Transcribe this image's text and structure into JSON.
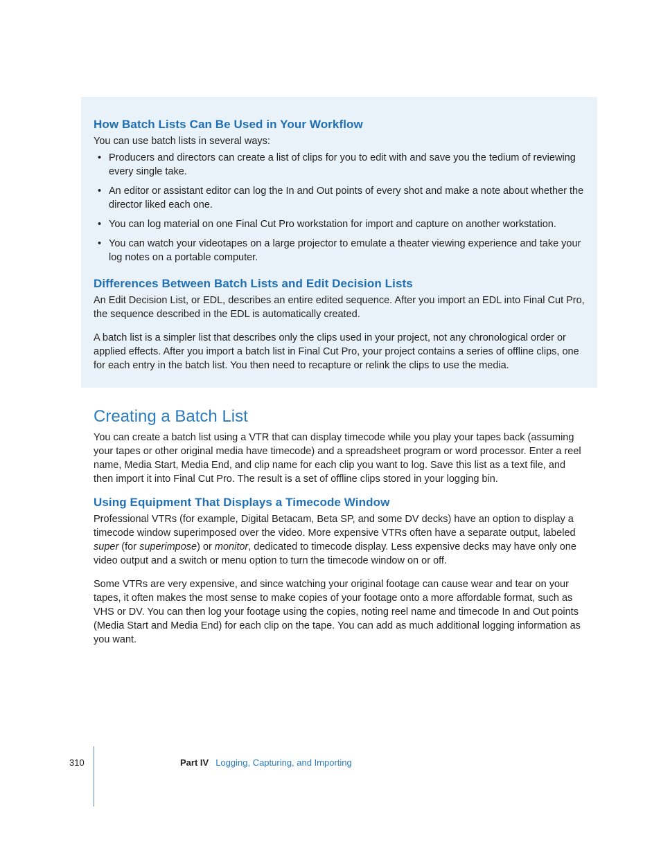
{
  "callout": {
    "h3a": "How Batch Lists Can Be Used in Your Workflow",
    "intro": "You can use batch lists in several ways:",
    "bullets": [
      "Producers and directors can create a list of clips for you to edit with and save you the tedium of reviewing every single take.",
      "An editor or assistant editor can log the In and Out points of every shot and make a note about whether the director liked each one.",
      "You can log material on one Final Cut Pro workstation for import and capture on another workstation.",
      "You can watch your videotapes on a large projector to emulate a theater viewing experience and take your log notes on a portable computer."
    ],
    "h3b": "Differences Between Batch Lists and Edit Decision Lists",
    "p1": "An Edit Decision List, or EDL, describes an entire edited sequence. After you import an EDL into Final Cut Pro, the sequence described in the EDL is automatically created.",
    "p2": "A batch list is a simpler list that describes only the clips used in your project, not any chronological order or applied effects. After you import a batch list in Final Cut Pro, your project contains a series of offline clips, one for each entry in the batch list. You then need to recapture or relink the clips to use the media."
  },
  "section1": {
    "h2": "Creating a Batch List",
    "p1": "You can create a batch list using a VTR that can display timecode while you play your tapes back (assuming your tapes or other original media have timecode) and a spreadsheet program or word processor. Enter a reel name, Media Start, Media End, and clip name for each clip you want to log. Save this list as a text file, and then import it into Final Cut Pro. The result is a set of offline clips stored in your logging bin."
  },
  "section2": {
    "h3": "Using Equipment That Displays a Timecode Window",
    "p1_pre": "Professional VTRs (for example, Digital Betacam, Beta SP, and some DV decks) have an option to display a timecode window superimposed over the video. More expensive VTRs often have a separate output, labeled ",
    "p1_em1": "super",
    "p1_mid1": " (for ",
    "p1_em2": "superimpose",
    "p1_mid2": ") or ",
    "p1_em3": "monitor",
    "p1_post": ", dedicated to timecode display. Less expensive decks may have only one video output and a switch or menu option to turn the timecode window on or off.",
    "p2": "Some VTRs are very expensive, and since watching your original footage can cause wear and tear on your tapes, it often makes the most sense to make copies of your footage onto a more affordable format, such as VHS or DV. You can then log your footage using the copies, noting reel name and timecode In and Out points (Media Start and Media End) for each clip on the tape. You can add as much additional logging information as you want."
  },
  "footer": {
    "page": "310",
    "part": "Part IV",
    "title": "Logging, Capturing, and Importing"
  }
}
